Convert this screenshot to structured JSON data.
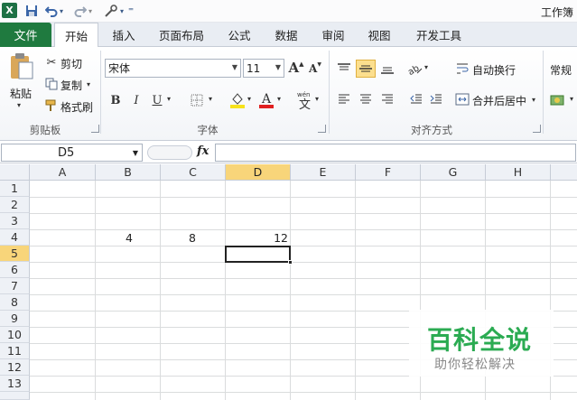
{
  "qat": {
    "app_icon": "X",
    "save_icon": "save-icon",
    "undo_icon": "undo-icon",
    "redo_icon": "redo-icon",
    "tools_icon": "customize-icon",
    "title": "工作簿"
  },
  "tabs": {
    "file": "文件",
    "home": "开始",
    "insert": "插入",
    "page_layout": "页面布局",
    "formulas": "公式",
    "data": "数据",
    "review": "审阅",
    "view": "视图",
    "developer": "开发工具"
  },
  "ribbon": {
    "clipboard": {
      "paste": "粘贴",
      "cut": "剪切",
      "copy": "复制",
      "format_painter": "格式刷",
      "label": "剪贴板"
    },
    "font": {
      "font_name": "宋体",
      "font_size": "11",
      "bold": "B",
      "italic": "I",
      "underline": "U",
      "grow": "A",
      "shrink": "A",
      "label": "字体",
      "font_color": "#e02020",
      "fill_color": "#f7e21b"
    },
    "alignment": {
      "wrap_text": "自动换行",
      "merge_center": "合并后居中",
      "label": "对齐方式"
    },
    "number": {
      "format": "常规"
    }
  },
  "formula_bar": {
    "name_box": "D5",
    "fx": "fx",
    "value": ""
  },
  "grid": {
    "columns": [
      "A",
      "B",
      "C",
      "D",
      "E",
      "F",
      "G",
      "H"
    ],
    "selected_column": "D",
    "rows": [
      "1",
      "2",
      "3",
      "4",
      "5",
      "6",
      "7",
      "8",
      "9",
      "10",
      "11",
      "12",
      "13"
    ],
    "selected_row": "5",
    "cells": {
      "B4": "4",
      "C4": "8",
      "D4": "12"
    },
    "active_cell": "D5"
  },
  "watermark": {
    "main": "百科全说",
    "sub": "助你轻松解决"
  },
  "colors": {
    "excel_green": "#1f7a3f",
    "selection_header": "#f8d57a",
    "watermark_green": "#2bab52"
  }
}
